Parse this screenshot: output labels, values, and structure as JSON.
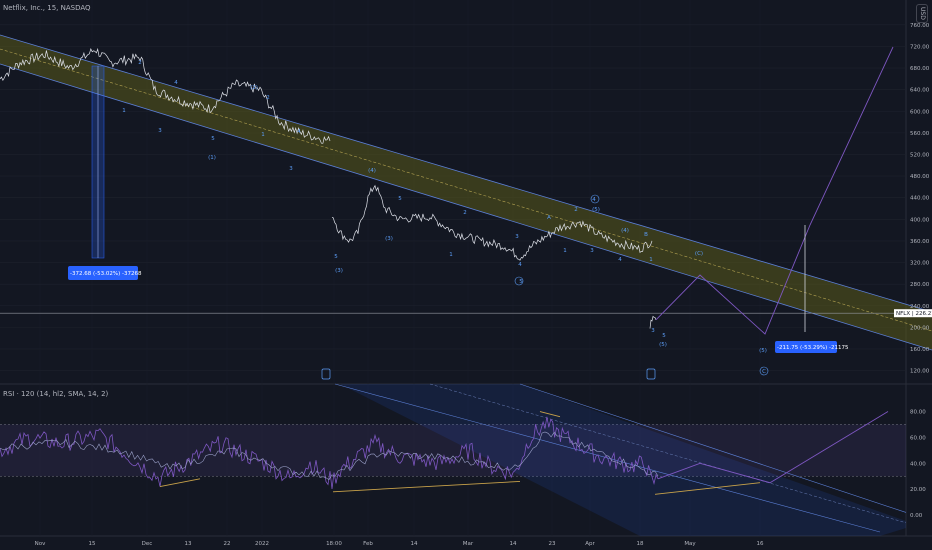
{
  "header": {
    "title": "Netflix, Inc., 15, NASDAQ",
    "currency": "USD"
  },
  "rsi": {
    "title": "RSI · 120 (14, hl2, SMA, 14, 2)"
  },
  "chart_data": [
    {
      "type": "line",
      "name": "price",
      "ylim": [
        110,
        780
      ],
      "y_ticks": [
        120,
        160,
        200,
        240,
        280,
        320,
        360,
        400,
        440,
        480,
        520,
        560,
        600,
        640,
        680,
        720,
        760
      ],
      "y_tick_labels": [
        "120.00",
        "160.00",
        "200.00",
        "240.00",
        "280.00",
        "320.00",
        "360.00",
        "400.00",
        "440.00",
        "480.00",
        "520.00",
        "560.00",
        "600.00",
        "640.00",
        "680.00",
        "720.00",
        "760.00"
      ],
      "x_tick_labels": [
        "Nov",
        "15",
        "Dec",
        "13",
        "22",
        "2022",
        "18:00",
        "Feb",
        "14",
        "Mar",
        "14",
        "23",
        "Apr",
        "18",
        "May",
        "16"
      ],
      "last_price_label": "NFLX",
      "last_price": "226.21",
      "measure_1": "-372.68 (-53.02%) -37268",
      "measure_2": "-211.75 (-53.29%) -21175",
      "wave_labels": [
        "1",
        "2",
        "3",
        "4",
        "5",
        "(1)",
        "(2)",
        "1",
        "2",
        "3",
        "4",
        "5",
        "(3)",
        "(4)",
        "5",
        "(3)",
        "1",
        "2",
        "3",
        "4",
        "5",
        "A",
        "1",
        "2",
        "3",
        "4",
        "(5)",
        "B",
        "(C)",
        "(4)",
        "4",
        "1",
        "3",
        "5",
        "(5)",
        "(5)",
        "C"
      ]
    },
    {
      "type": "line",
      "name": "RSI",
      "ylim": [
        -10,
        92
      ],
      "y_ticks": [
        0,
        20,
        40,
        60,
        80
      ],
      "y_tick_labels": [
        "0.00",
        "20.00",
        "40.00",
        "60.00",
        "80.00"
      ]
    }
  ],
  "colors": {
    "background": "#131722",
    "price": "#e0e3eb",
    "channel": "#2962ff",
    "channel_fill": "#5a5a1a",
    "rsi": "#7e57c2",
    "projection": "#7e57c2",
    "measure_label": "#2962ff"
  }
}
